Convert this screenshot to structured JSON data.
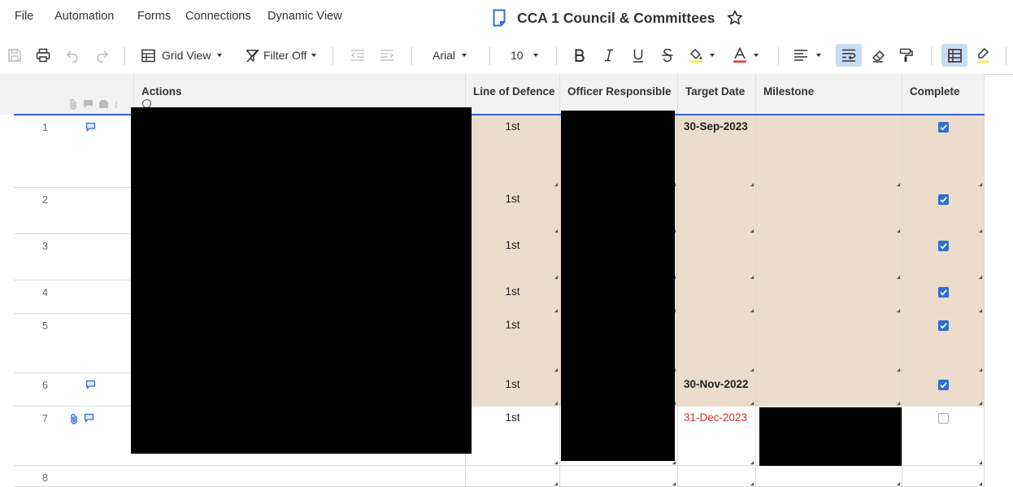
{
  "menu": {
    "file": "File",
    "automation": "Automation",
    "forms": "Forms",
    "connections": "Connections",
    "dynamic_view": "Dynamic View"
  },
  "sheet": {
    "title": "CCA 1 Council & Committees"
  },
  "toolbar": {
    "view_label": "Grid View",
    "filter_label": "Filter Off",
    "font_family": "Arial",
    "font_size": "10"
  },
  "columns": {
    "actions": "Actions",
    "line_of_defence": "Line of Defence",
    "officer_responsible": "Officer Responsible",
    "target_date": "Target Date",
    "milestone": "Milestone",
    "complete": "Complete"
  },
  "rows": [
    {
      "num": "1",
      "line": "1st",
      "target": "30-Sep-2023",
      "complete": true
    },
    {
      "num": "2",
      "line": "1st",
      "target": "",
      "complete": true
    },
    {
      "num": "3",
      "line": "1st",
      "target": "",
      "complete": true
    },
    {
      "num": "4",
      "line": "1st",
      "target": "",
      "complete": true
    },
    {
      "num": "5",
      "line": "1st",
      "target": "",
      "complete": true
    },
    {
      "num": "6",
      "line": "1st",
      "target": "30-Nov-2022",
      "complete": true
    },
    {
      "num": "7",
      "line": "1st",
      "target": "31-Dec-2023",
      "complete": false
    },
    {
      "num": "8",
      "line": "",
      "target": "",
      "complete": null
    }
  ],
  "colors": {
    "shaded_row": "#ecdccb",
    "header_line": "#3a5fcd",
    "checkbox_on": "#2f6fd0",
    "overdue_red": "#d32f2f",
    "comment_icon": "#2f6fd0"
  }
}
